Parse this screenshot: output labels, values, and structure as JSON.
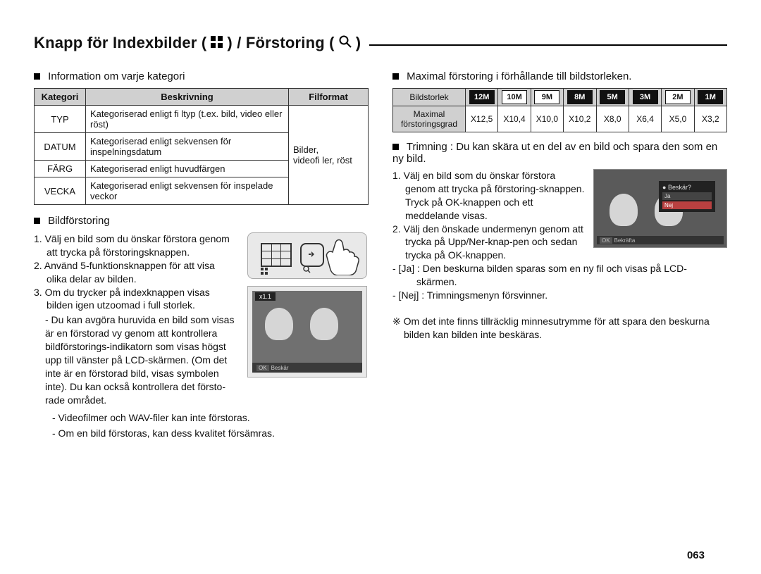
{
  "page_number": "063",
  "title": {
    "prefix": "Knapp för Indexbilder (",
    "mid": ") / Förstoring (",
    "suffix": ")"
  },
  "left": {
    "category_heading": "Information om varje kategori",
    "table": {
      "headers": {
        "c1": "Kategori",
        "c2": "Beskrivning",
        "c3": "Filformat"
      },
      "fileformat_shared": "Bilder,\nvideofi ler, röst",
      "rows": [
        {
          "cat": "TYP",
          "desc": "Kategoriserad enligt fi ltyp (t.ex. bild, video eller röst)"
        },
        {
          "cat": "DATUM",
          "desc": "Kategoriserad enligt sekvensen för inspelningsdatum"
        },
        {
          "cat": "FÄRG",
          "desc": "Kategoriserad enligt huvudfärgen"
        },
        {
          "cat": "VECKA",
          "desc": "Kategoriserad enligt sekvensen för inspelade veckor"
        }
      ]
    },
    "enlarge_heading": "Bildförstoring",
    "enlarge_steps": {
      "s1": "1. Välj en bild som du önskar förstora genom att trycka på förstoringsknappen.",
      "s2": "2. Använd 5-funktionsknappen för att visa olika delar av bilden.",
      "s3": "3. Om du trycker på indexknappen visas bilden igen utzoomad i full storlek.",
      "d1": "- Du kan avgöra huruvida en bild som visas är en förstorad vy genom att kontrollera bildförstorings-indikatorn som visas högst upp till vänster på LCD-skärmen. (Om det inte är en förstorad bild, visas symbolen inte). Du kan också kontrollera det försto-rade området.",
      "d2": "- Videofilmer och WAV-filer kan inte förstoras.",
      "d3": "- Om en bild förstoras, kan dess kvalitet försämras."
    },
    "photo_badge": "x1.1",
    "photo_bar": "Beskär"
  },
  "right": {
    "zoom_heading": "Maximal förstoring i förhållande till bildstorleken.",
    "zoom_table": {
      "row1_label": "Bildstorlek",
      "row2_label": "Maximal förstoringsgrad",
      "sizes": [
        "12M",
        "10M",
        "9M",
        "8M",
        "5M",
        "3M",
        "2M",
        "1M"
      ],
      "values": [
        "X12,5",
        "X10,4",
        "X10,0",
        "X10,2",
        "X8,0",
        "X6,4",
        "X5,0",
        "X3,2"
      ]
    },
    "trim_heading_a": "Trimning : ",
    "trim_heading_b": "Du kan skära ut en del av en bild och spara den som en ny bild.",
    "trim_steps": {
      "s1": "1. Välj en bild som du önskar förstora genom att trycka på förstoring-sknappen. Tryck på OK-knappen och ett meddelande visas.",
      "s2": "2. Välj den önskade undermenyn genom att trycka på Upp/Ner-knap-pen och sedan trycka på OK-knappen."
    },
    "ja": "- [Ja]  : Den beskurna bilden sparas som en ny fil och visas på LCD-skärmen.",
    "nej": "- [Nej] : Trimningsmenyn försvinner.",
    "dialog": {
      "title": "Beskär?",
      "opt_yes": "Ja",
      "opt_no": "Nej"
    },
    "dialog_bar": "Bekräfta",
    "note": "※ Om det inte finns tillräcklig minnesutrymme för att spara den beskurna bilden kan bilden inte beskäras."
  },
  "chart_data": {
    "type": "table",
    "title": "Maximal förstoring i förhållande till bildstorleken.",
    "categories": [
      "12M",
      "10M",
      "9M",
      "8M",
      "5M",
      "3M",
      "2M",
      "1M"
    ],
    "values": [
      12.5,
      10.4,
      10.0,
      10.2,
      8.0,
      6.4,
      5.0,
      3.2
    ],
    "xlabel": "Bildstorlek",
    "ylabel": "Maximal förstoringsgrad"
  }
}
